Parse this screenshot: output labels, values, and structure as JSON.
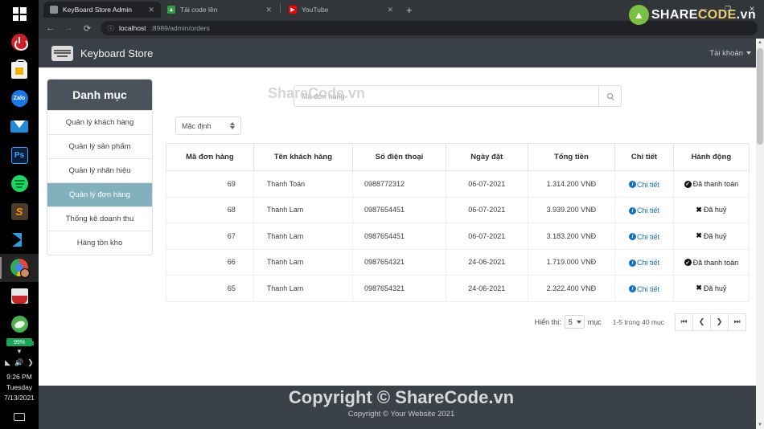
{
  "taskbar": {
    "icons": [
      {
        "name": "windows-start-icon",
        "label": "Start"
      },
      {
        "name": "power-icon",
        "label": "Power"
      },
      {
        "name": "microsoft-store-icon",
        "label": "Microsoft Store"
      },
      {
        "name": "zalo-icon",
        "label": "Zalo"
      },
      {
        "name": "mail-icon",
        "label": "Mail"
      },
      {
        "name": "photoshop-icon",
        "label": "Ps"
      },
      {
        "name": "spotify-icon",
        "label": "Spotify"
      },
      {
        "name": "sublime-text-icon",
        "label": "S"
      },
      {
        "name": "vscode-icon",
        "label": "Visual Studio Code"
      },
      {
        "name": "chrome-icon",
        "label": "Google Chrome"
      },
      {
        "name": "app-red-icon",
        "label": "App"
      },
      {
        "name": "app-green-icon",
        "label": "App"
      }
    ],
    "battery": "99%",
    "clock": {
      "time": "9:26 PM",
      "day": "Tuesday",
      "date": "7/13/2021"
    }
  },
  "browser": {
    "tabs": [
      {
        "title": "KeyBoard Store Admin",
        "favicon": "keyboard-icon",
        "active": true
      },
      {
        "title": "Tải code lên",
        "favicon": "upload-icon",
        "active": false
      },
      {
        "title": "YouTube",
        "favicon": "youtube-icon",
        "active": false
      }
    ],
    "new_tab_label": "+",
    "close_label": "✕",
    "window_controls": {
      "minimize": "—",
      "maximize": "❐",
      "close": "✕"
    },
    "nav": {
      "back": "←",
      "forward": "→",
      "reload": "⟳"
    },
    "address": {
      "host": "localhost",
      "path": ":8989/admin/orders",
      "info_icon": "ⓘ"
    }
  },
  "navbar": {
    "brand": "Keyboard Store",
    "account": "Tài khoản"
  },
  "sidebar": {
    "title": "Danh mục",
    "items": [
      {
        "label": "Quản lý khách hàng",
        "active": false
      },
      {
        "label": "Quản lý sản phẩm",
        "active": false
      },
      {
        "label": "Quản lý nhãn hiệu",
        "active": false
      },
      {
        "label": "Quản lý đơn hàng",
        "active": true
      },
      {
        "label": "Thống kê doanh thu",
        "active": false
      },
      {
        "label": "Hàng tồn kho",
        "active": false
      }
    ]
  },
  "search": {
    "placeholder": "Mã đơn hàng",
    "value": "",
    "button_icon": "search-icon"
  },
  "sort": {
    "selected": "Mặc định"
  },
  "table": {
    "headers": [
      "Mã đơn hàng",
      "Tên khách hàng",
      "Số điện thoại",
      "Ngày đặt",
      "Tổng tiền",
      "Chi tiết",
      "Hành động"
    ],
    "rows": [
      {
        "id": "69",
        "customer": "Thanh Toán",
        "phone": "0988772312",
        "date": "06-07-2021",
        "total": "1.314.200 VNĐ",
        "detail": "Chi tiết",
        "action": "Đã thanh toán",
        "action_type": "paid"
      },
      {
        "id": "68",
        "customer": "Thanh Lam",
        "phone": "0987654451",
        "date": "06-07-2021",
        "total": "3.939.200 VNĐ",
        "detail": "Chi tiết",
        "action": "Đã huỷ",
        "action_type": "cancelled"
      },
      {
        "id": "67",
        "customer": "Thanh Lam",
        "phone": "0987654451",
        "date": "06-07-2021",
        "total": "3.183.200 VNĐ",
        "detail": "Chi tiết",
        "action": "Đã huỷ",
        "action_type": "cancelled"
      },
      {
        "id": "66",
        "customer": "Thanh Lam",
        "phone": "0987654321",
        "date": "24-06-2021",
        "total": "1.719.000 VNĐ",
        "detail": "Chi tiết",
        "action": "Đã thanh toán",
        "action_type": "paid"
      },
      {
        "id": "65",
        "customer": "Thanh Lam",
        "phone": "0987654321",
        "date": "24-06-2021",
        "total": "2.322.400 VNĐ",
        "detail": "Chi tiết",
        "action": "Đã huỷ",
        "action_type": "cancelled"
      }
    ]
  },
  "pagination": {
    "show_label": "Hiển thị:",
    "page_size": "5",
    "unit_label": "mục",
    "range_text": "1-5 trong 40 mục",
    "first": "⏮",
    "prev": "❮",
    "next": "❯",
    "last": "⏭"
  },
  "footer": {
    "text": "Copyright © Your Website 2021"
  },
  "watermark": {
    "logo_part1": "SHARE",
    "logo_part2": "CODE",
    "logo_part3": ".vn",
    "logo_mark": "▲",
    "middle": "ShareCode.vn",
    "footer": "Copyright © ShareCode.vn"
  },
  "colors": {
    "navbar": "#3a4149",
    "sidebar_header": "#4a535c",
    "sidebar_active": "#82b0bd",
    "link": "#1271c0",
    "watermark_green": "#7ac143"
  }
}
